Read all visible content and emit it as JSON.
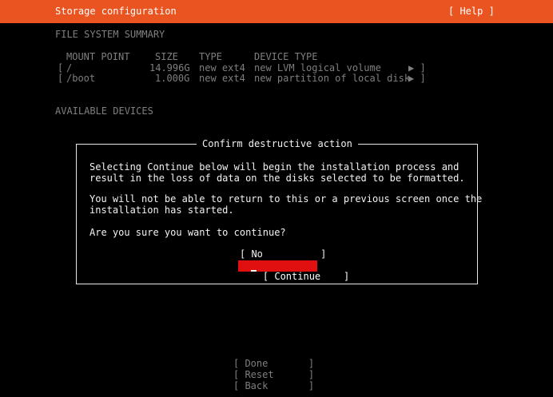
{
  "header": {
    "title": "Storage configuration",
    "help": "[ Help ]"
  },
  "summary": {
    "label": "FILE SYSTEM SUMMARY",
    "columns": [
      "MOUNT POINT",
      "SIZE",
      "TYPE",
      "DEVICE TYPE"
    ],
    "rows": [
      {
        "open": "[",
        "mount": "/",
        "size": "14.996G",
        "type": "new ext4",
        "device": "new LVM logical volume",
        "arrow": "▶ ]"
      },
      {
        "open": "[",
        "mount": "/boot",
        "size": "1.000G",
        "type": "new ext4",
        "device": "new partition of local disk",
        "arrow": "▶ ]"
      }
    ]
  },
  "available": {
    "label": "AVAILABLE DEVICES"
  },
  "dialog": {
    "title": "Confirm destructive action",
    "para1_line1": "Selecting Continue below will begin the installation process and",
    "para1_line2": "result in the loss of data on the disks selected to be formatted.",
    "para2_line1": "You will not be able to return to this or a previous screen once the",
    "para2_line2": "installation has started.",
    "question": "Are you sure you want to continue?",
    "no_button": "[ No          ]",
    "continue_button": "[ Continue    ]"
  },
  "footer": {
    "done": "[ Done       ]",
    "reset": "[ Reset      ]",
    "back": "[ Back       ]"
  },
  "colors": {
    "header_bg": "#e95420",
    "button_focus": "#e01010"
  }
}
